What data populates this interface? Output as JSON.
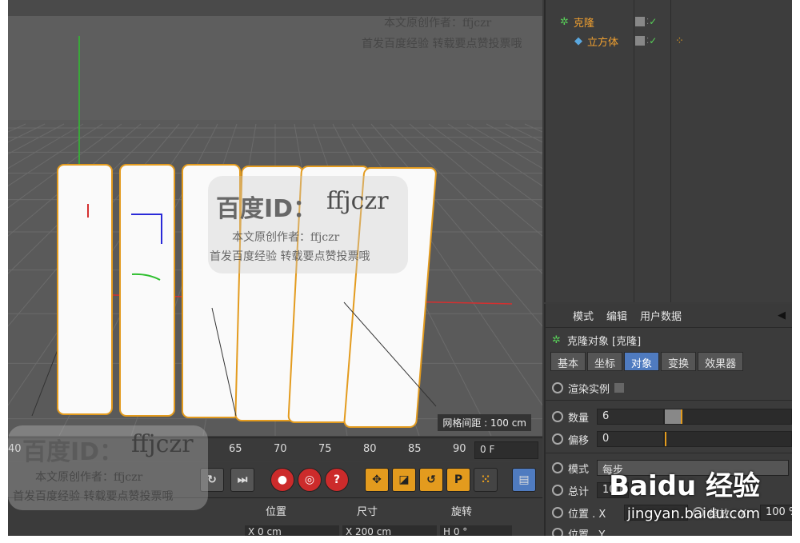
{
  "viewport": {
    "grid_spacing": "网格间距 : 100 cm"
  },
  "object_manager": {
    "objects": [
      {
        "name": "克隆"
      },
      {
        "name": "立方体"
      }
    ]
  },
  "attributes": {
    "menu": [
      "模式",
      "编辑",
      "用户数据"
    ],
    "title": "克隆对象 [克隆]",
    "tabs": [
      "基本",
      "坐标",
      "对象",
      "变换",
      "效果器"
    ],
    "active_tab": "对象",
    "render_instances_label": "渲染实例",
    "count_label": "数量",
    "count_value": "6",
    "offset_label": "偏移",
    "offset_value": "0",
    "mode_label": "模式",
    "mode_value": "每步",
    "total_label": "总计",
    "total_value": "100",
    "position_label": "位置 . X",
    "scale_label": "缩放 . X",
    "scale_value": "100 %",
    "position2_label": "位置 . Y"
  },
  "timeline": {
    "ticks": [
      "65",
      "70",
      "75",
      "80",
      "85",
      "90"
    ],
    "left_tick": "40",
    "frame_value": "0 F"
  },
  "coordinates": {
    "headers": [
      "位置",
      "尺寸",
      "旋转"
    ],
    "x_pos": "X  0 cm",
    "x_size": "X  200 cm",
    "h_rot": "H  0 °"
  },
  "watermarks": {
    "brand": "百度ID：",
    "id": "ffjczr",
    "author": "本文原创作者：ffjczr",
    "notice": "首发百度经验 转载要点赞投票哦",
    "baidu_logo": "Baidu 经验",
    "baidu_url": "jingyan.baidu.com"
  },
  "colors": {
    "accent_blue": "#4f7bc0",
    "object_orange": "#f0a030",
    "check_green": "#58d058"
  }
}
